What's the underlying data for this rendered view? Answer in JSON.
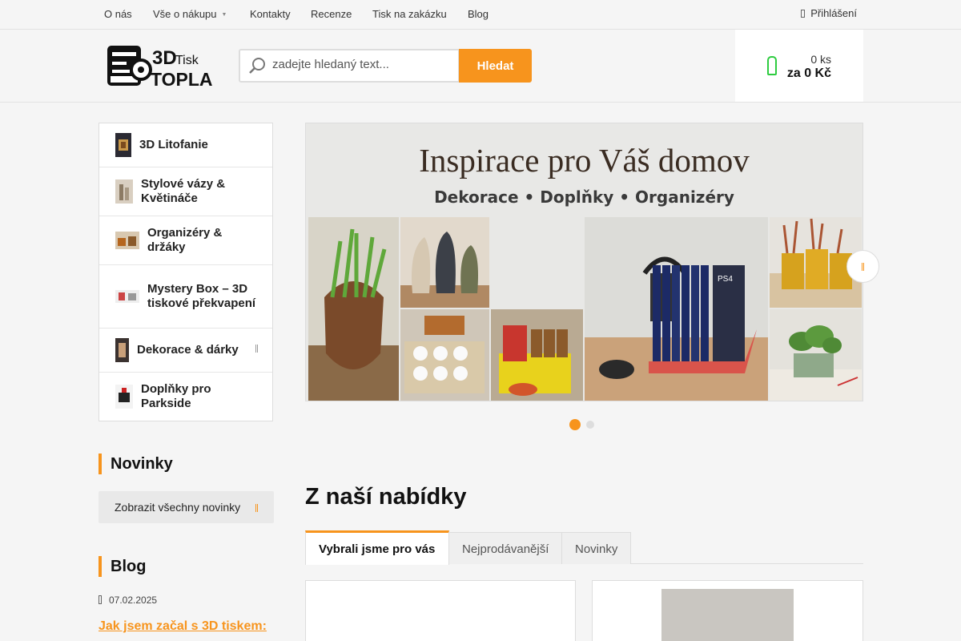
{
  "topnav": {
    "items": [
      "O nás",
      "Vše o nákupu",
      "Kontakty",
      "Recenze",
      "Tisk na zakázku",
      "Blog"
    ],
    "login": "Přihlášení"
  },
  "header": {
    "logo": {
      "line1": "3D",
      "line1_small": "Tisk",
      "line2": "TOPLA"
    },
    "search": {
      "placeholder": "zadejte hledaný text...",
      "button": "Hledat"
    },
    "cart": {
      "qty": "0 ks",
      "price": "za 0 Kč"
    }
  },
  "categories": [
    {
      "label": "3D Litofanie"
    },
    {
      "label": "Stylové vázy & Květináče"
    },
    {
      "label": "Organizéry & držáky"
    },
    {
      "label": "Mystery Box – 3D tiskové překvapení"
    },
    {
      "label": "Dekorace & dárky"
    },
    {
      "label": "Doplňky pro Parkside"
    }
  ],
  "news": {
    "heading": "Novinky",
    "all_button": "Zobrazit všechny novinky"
  },
  "blog": {
    "heading": "Blog",
    "date": "07.02.2025",
    "title": "Jak jsem začal s 3D tiskem:"
  },
  "banner": {
    "title": "Inspirace pro Váš domov",
    "subtitle": "Dekorace • Doplňky • Organizéry",
    "cover_text": "PS4",
    "active_slide": 1,
    "slide_count": 2
  },
  "offers": {
    "heading": "Z naší nabídky",
    "tabs": [
      "Vybrali jsme pro vás",
      "Nejprodávanější",
      "Novinky"
    ],
    "active_tab": 0
  },
  "colors": {
    "accent": "#f7941d",
    "cart_icon": "#2ecc40"
  }
}
